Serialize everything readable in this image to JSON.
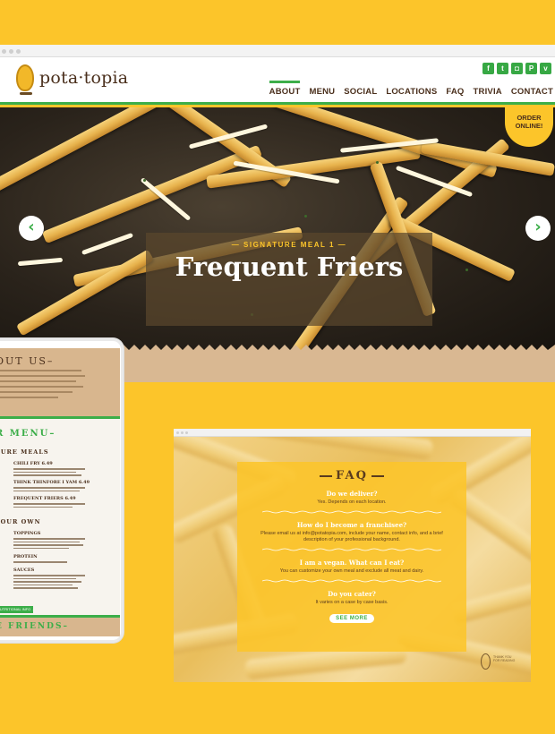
{
  "site": {
    "logo_text": "pota·topia",
    "social_icons": [
      {
        "name": "facebook-icon",
        "glyph": "f"
      },
      {
        "name": "twitter-icon",
        "glyph": "t"
      },
      {
        "name": "instagram-icon",
        "glyph": "◘"
      },
      {
        "name": "pinterest-icon",
        "glyph": "P"
      },
      {
        "name": "vine-icon",
        "glyph": "v"
      }
    ],
    "nav": [
      "ABOUT",
      "MENU",
      "SOCIAL",
      "LOCATIONS",
      "FAQ",
      "TRIVIA",
      "CONTACT"
    ],
    "order_badge": "ORDER ONLINE!",
    "hero": {
      "subtitle": "— SIGNATURE MEAL 1 —",
      "title": "Frequent Friers",
      "prev_arrow": "‹",
      "next_arrow": "›"
    }
  },
  "tablet": {
    "about_heading": "OUT US–",
    "menu_heading": "R MENU–",
    "signature_heading": "TURE MEALS",
    "items": [
      {
        "name": "CHILI FRY",
        "price": "6.49"
      },
      {
        "name": "THINK THINFORE I YAM",
        "price": "6.49"
      },
      {
        "name": "FREQUENT FRIERS",
        "price": "6.49"
      }
    ],
    "own_heading": "YOUR OWN",
    "own_items": [
      "TOPPINGS",
      "PROTEIN",
      "SAUCES"
    ],
    "nutrition_link": "NUTRITIONAL INFO →",
    "friends_heading": "E FRIENDS–"
  },
  "faq": {
    "title": "FAQ",
    "items": [
      {
        "q": "Do we deliver?",
        "a": "Yes. Depends on each location."
      },
      {
        "q": "How do I become a franchisee?",
        "a": "Please email us at info@potatopia.com, include your name, contact info, and a brief description of your professional background."
      },
      {
        "q": "I am a vegan. What can I eat?",
        "a": "You can customize your own meal and exclude all meat and dairy."
      },
      {
        "q": "Do you cater?",
        "a": "It varies on a case by case basis."
      }
    ],
    "see_more": "SEE MORE",
    "corner_text": "THANK YOU\nFOR READING"
  },
  "colors": {
    "background": "#fcc52a",
    "accent_green": "#3cae49",
    "brown": "#4a2f1c",
    "kraft": "#d9b892"
  }
}
